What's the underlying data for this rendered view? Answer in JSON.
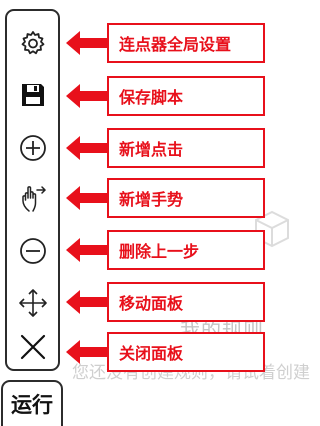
{
  "background": {
    "title": "我的规则",
    "subtitle": "您还没有创建规则，请试着创建"
  },
  "toolbar": {
    "tools": [
      {
        "icon": "gear-icon"
      },
      {
        "icon": "floppy-disk-icon"
      },
      {
        "icon": "plus-circle-icon"
      },
      {
        "icon": "swipe-hand-icon"
      },
      {
        "icon": "minus-circle-icon"
      },
      {
        "icon": "move-arrows-icon"
      },
      {
        "icon": "close-icon"
      }
    ],
    "run_label": "运行"
  },
  "callouts": [
    {
      "label": "连点器全局设置"
    },
    {
      "label": "保存脚本"
    },
    {
      "label": "新增点击"
    },
    {
      "label": "新增手势"
    },
    {
      "label": "删除上一步"
    },
    {
      "label": "移动面板"
    },
    {
      "label": "关闭面板"
    }
  ],
  "colors": {
    "callout": "#e8101b",
    "toolbar_border": "#2c2c2c"
  }
}
